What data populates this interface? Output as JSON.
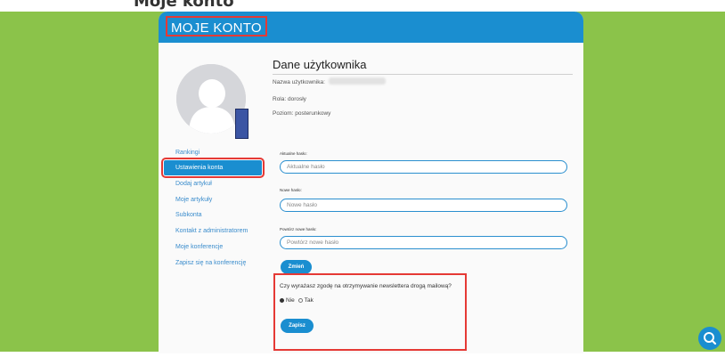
{
  "header": {
    "title": "MOJE KONTO"
  },
  "top_text": "Moje konto",
  "sidebar": {
    "items": [
      {
        "label": "Rankingi",
        "active": false
      },
      {
        "label": "Ustawienia konta",
        "active": true
      },
      {
        "label": "Dodaj artykuł",
        "active": false
      },
      {
        "label": "Moje artykuły",
        "active": false
      },
      {
        "label": "Subkonta",
        "active": false
      },
      {
        "label": "Kontakt z administratorem",
        "active": false
      },
      {
        "label": "Moje konferencje",
        "active": false
      },
      {
        "label": "Zapisz się na konferencję",
        "active": false
      }
    ]
  },
  "user": {
    "section_title": "Dane użytkownika",
    "username_label": "Nazwa użytkownika:",
    "role": "Rola: dorosły",
    "level": "Poziom: posterunkowy"
  },
  "password_form": {
    "current": {
      "label": "Aktualne hasło:",
      "placeholder": "Aktualne hasło"
    },
    "new": {
      "label": "Nowe hasło:",
      "placeholder": "Nowe hasło"
    },
    "repeat": {
      "label": "Powtórz nowe hasło:",
      "placeholder": "Powtórz nowe hasło"
    },
    "submit_label": "Zmień"
  },
  "newsletter": {
    "question": "Czy wyrażasz zgodę na otrzymywanie newslettera drogą mailową?",
    "options": [
      {
        "label": "Nie",
        "checked": true
      },
      {
        "label": "Tak",
        "checked": false
      }
    ],
    "submit_label": "Zapisz"
  },
  "icons": {
    "search": "search-icon",
    "avatar": "avatar-icon"
  },
  "colors": {
    "page_background": "#8bc34a",
    "accent": "#1a8ed0",
    "highlight_border": "#e53935",
    "sleeve": "#3b55a4"
  }
}
